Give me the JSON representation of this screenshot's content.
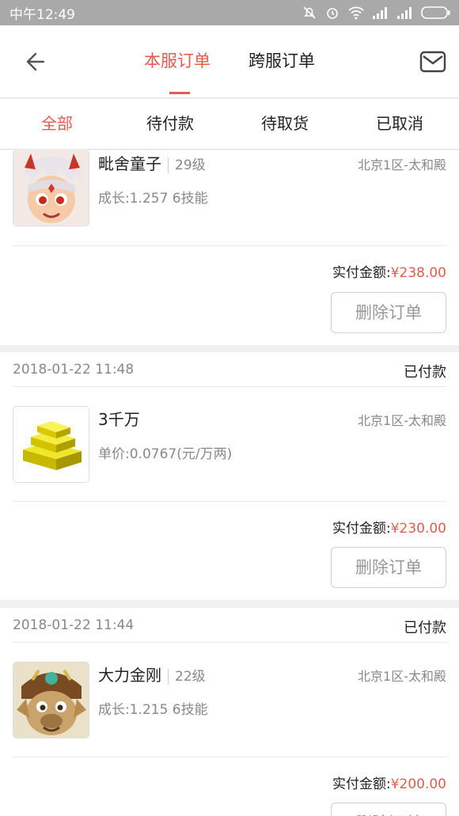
{
  "status_bar": {
    "time": "中午12:49"
  },
  "header": {
    "tabs": [
      {
        "label": "本服订单",
        "active": true
      },
      {
        "label": "跨服订单",
        "active": false
      }
    ]
  },
  "filters": [
    {
      "label": "全部",
      "active": true
    },
    {
      "label": "待付款"
    },
    {
      "label": "待取货"
    },
    {
      "label": "已取消"
    }
  ],
  "colors": {
    "accent": "#e35b4f",
    "muted_text": "#888888",
    "background": "#f0f0f0"
  },
  "orders": [
    {
      "time": "",
      "status": "",
      "item_name": "毗舍童子",
      "level": "29级",
      "server": "北京1区-太和殿",
      "detail": "成长:1.257 6技能",
      "amount_label": "实付金额:",
      "amount": "¥238.00",
      "action": "删除订单",
      "image": "pet-character-icon"
    },
    {
      "time": "2018-01-22 11:48",
      "status": "已付款",
      "item_name": "3千万",
      "level": "",
      "server": "北京1区-太和殿",
      "detail": "单价:0.0767(元/万两)",
      "amount_label": "实付金额:",
      "amount": "¥230.00",
      "action": "删除订单",
      "image": "gold-bars-icon"
    },
    {
      "time": "2018-01-22 11:44",
      "status": "已付款",
      "item_name": "大力金刚",
      "level": "22级",
      "server": "北京1区-太和殿",
      "detail": "成长:1.215 6技能",
      "amount_label": "实付金额:",
      "amount": "¥200.00",
      "action": "删除订单",
      "image": "pet-character-icon"
    }
  ]
}
